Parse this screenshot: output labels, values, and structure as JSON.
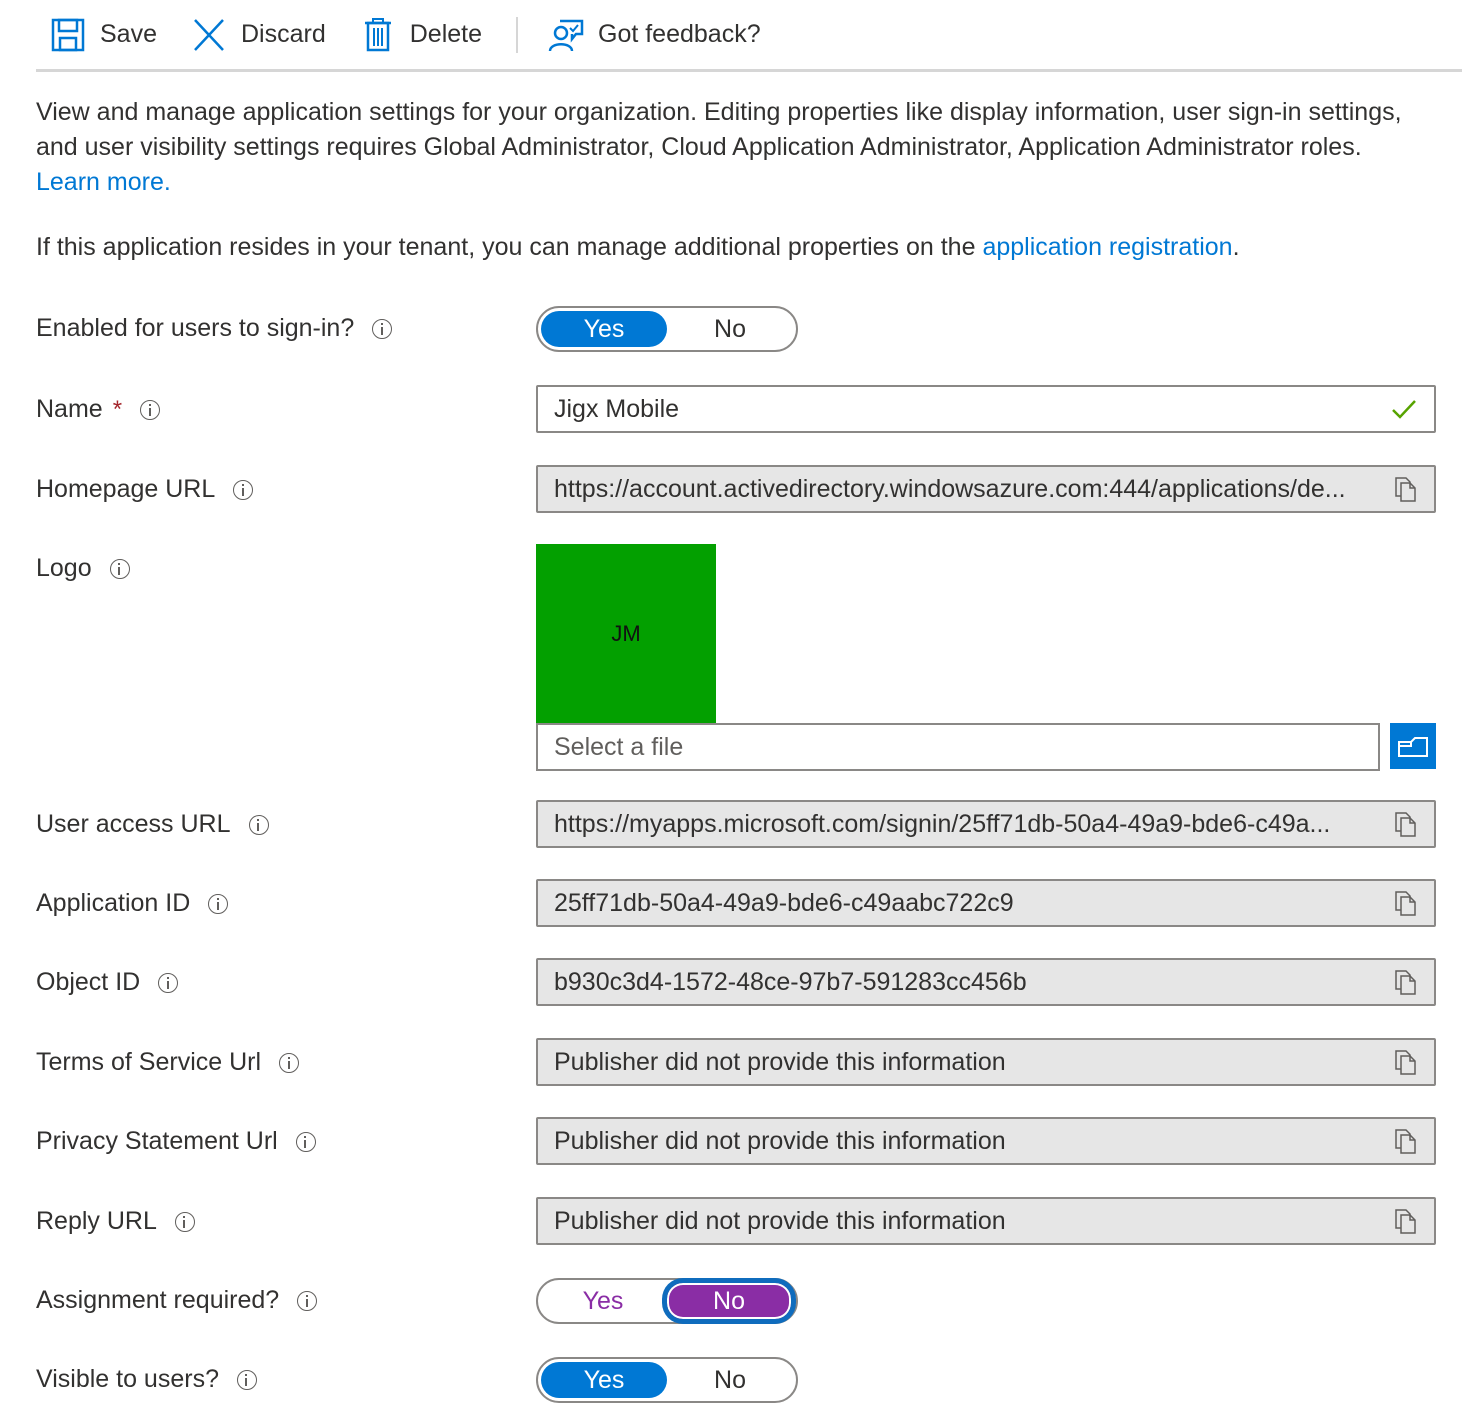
{
  "toolbar": {
    "save": "Save",
    "discard": "Discard",
    "delete": "Delete",
    "feedback": "Got feedback?"
  },
  "description": {
    "para1": "View and manage application settings for your organization. Editing properties like display information, user sign-in settings, and user visibility settings requires Global Administrator, Cloud Application Administrator, Application Administrator roles.",
    "learn_more": "Learn more.",
    "para2_prefix": "If this application resides in your tenant, you can manage additional properties on the",
    "app_registration": "application registration",
    "para2_suffix": "."
  },
  "fields": {
    "enabled": {
      "label": "Enabled for users to sign-in?",
      "yes": "Yes",
      "no": "No",
      "selected": "Yes"
    },
    "name": {
      "label": "Name",
      "required_mark": "*",
      "value": "Jigx Mobile",
      "valid": true
    },
    "homepage": {
      "label": "Homepage URL",
      "value": "https://account.activedirectory.windowsazure.com:444/applications/de..."
    },
    "logo": {
      "label": "Logo",
      "initials": "JM",
      "color": "#03a000",
      "file_placeholder": "Select a file"
    },
    "user_access": {
      "label": "User access URL",
      "value": "https://myapps.microsoft.com/signin/25ff71db-50a4-49a9-bde6-c49a..."
    },
    "app_id": {
      "label": "Application ID",
      "value": "25ff71db-50a4-49a9-bde6-c49aabc722c9"
    },
    "object_id": {
      "label": "Object ID",
      "value": "b930c3d4-1572-48ce-97b7-591283cc456b"
    },
    "tos": {
      "label": "Terms of Service Url",
      "value": "Publisher did not provide this information"
    },
    "privacy": {
      "label": "Privacy Statement Url",
      "value": "Publisher did not provide this information"
    },
    "reply": {
      "label": "Reply URL",
      "value": "Publisher did not provide this information"
    },
    "assignment": {
      "label": "Assignment required?",
      "yes": "Yes",
      "no": "No",
      "selected": "No"
    },
    "visible": {
      "label": "Visible to users?",
      "yes": "Yes",
      "no": "No",
      "selected": "Yes"
    }
  },
  "colors": {
    "accent": "#0078d4",
    "selected_purple": "#8a2da5",
    "required": "#a4262c",
    "valid_check": "#57a300"
  }
}
